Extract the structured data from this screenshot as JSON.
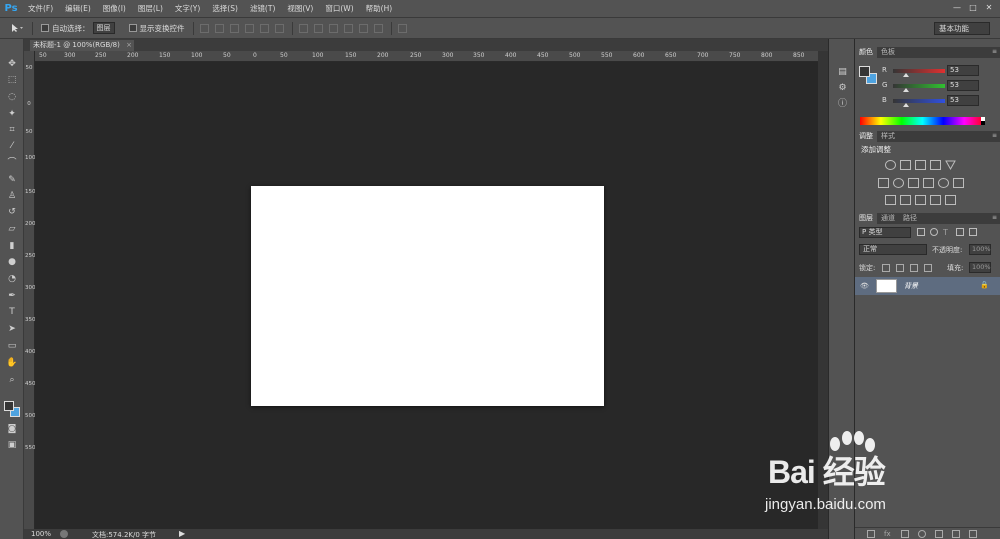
{
  "menubar": {
    "logo": "Ps",
    "items": [
      "文件(F)",
      "编辑(E)",
      "图像(I)",
      "图层(L)",
      "文字(Y)",
      "选择(S)",
      "滤镜(T)",
      "视图(V)",
      "窗口(W)",
      "帮助(H)"
    ],
    "window_controls": [
      "—",
      "□",
      "✕"
    ]
  },
  "options": {
    "auto_select_label": "自动选择：",
    "auto_select_value": "图层",
    "show_transform_label": "显示变换控件",
    "workspace": "基本功能"
  },
  "document": {
    "tab_title": "未标题-1 @ 100%(RGB/8)",
    "tab_close": "×"
  },
  "ruler": {
    "horizontal_labels": [
      "50",
      "300",
      "250",
      "200",
      "150",
      "100",
      "50",
      "0",
      "50",
      "100",
      "150",
      "200",
      "250",
      "300",
      "350",
      "400",
      "450",
      "500",
      "550",
      "600",
      "650",
      "700",
      "750",
      "800",
      "850"
    ],
    "vertical_labels": [
      "50",
      "0",
      "50",
      "100",
      "150",
      "200",
      "250",
      "300",
      "350",
      "400",
      "450",
      "500",
      "550"
    ]
  },
  "status": {
    "zoom": "100%",
    "doc_info": "文档:574.2K/0 字节",
    "arrow": "▶"
  },
  "color_panel": {
    "tabs": [
      "颜色",
      "色板"
    ],
    "channels": [
      {
        "letter": "R",
        "value": "53",
        "color": "#e03030"
      },
      {
        "letter": "G",
        "value": "53",
        "color": "#30c030"
      },
      {
        "letter": "B",
        "value": "53",
        "color": "#3050e0"
      }
    ]
  },
  "adjust_panel": {
    "tabs": [
      "调整",
      "样式"
    ],
    "title": "添加调整"
  },
  "layers_panel": {
    "tabs": [
      "图层",
      "通道",
      "路径"
    ],
    "filter": "P 类型",
    "blend_mode": "正常",
    "opacity_label": "不透明度:",
    "opacity_value": "100%",
    "lock_label": "锁定:",
    "fill_label": "填充:",
    "fill_value": "100%",
    "layer_name": "背景"
  },
  "watermark": {
    "brand": "Bai 经验",
    "url": "jingyan.baidu.com"
  },
  "colors": {
    "accent": "#35a6f2",
    "foreground_swatch": "#353535",
    "background_swatch": "#4ea3e0",
    "selected_layer": "#5e6c80"
  }
}
